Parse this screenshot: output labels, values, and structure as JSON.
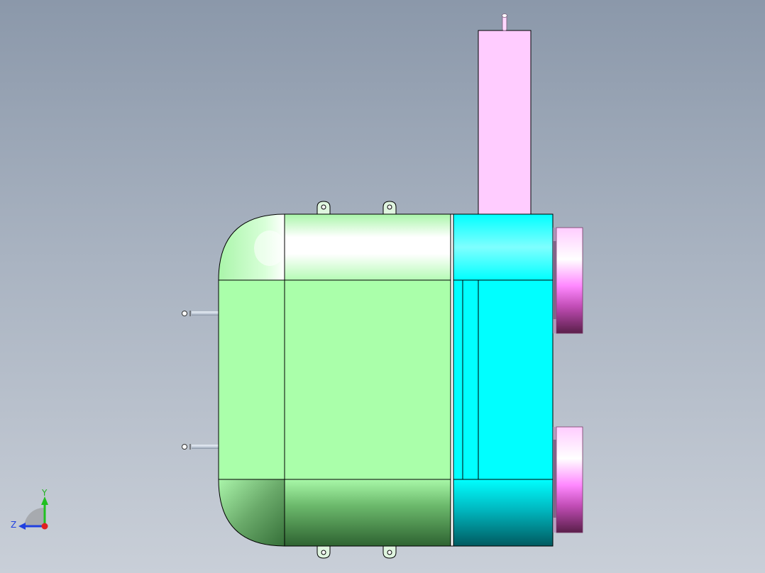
{
  "app": {
    "view": "cad-model-viewport"
  },
  "colors": {
    "background_top": "#8b98aa",
    "background_bottom": "#c9cfd8",
    "tank_green": "#aaffaa",
    "tank_green_dark": "#2f6a33",
    "collector_cyan": "#00ffff",
    "collector_cyan_dark": "#005f66",
    "chimney_pink": "#ffccff",
    "flange_magenta": "#ff66ff",
    "flange_dark": "#5a1f4a",
    "outline": "#000000",
    "axis_x": "#e02020",
    "axis_y": "#20c020",
    "axis_z": "#2040e0"
  },
  "triad": {
    "y_label": "Y",
    "z_label": "Z"
  }
}
